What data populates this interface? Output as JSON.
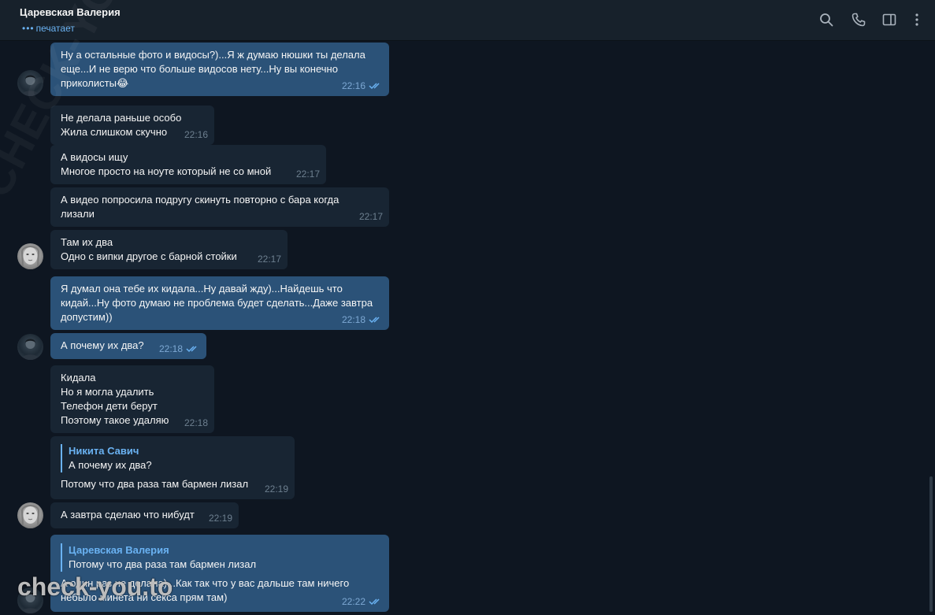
{
  "header": {
    "chat_name": "Царевская Валерия",
    "status_dots": "•••",
    "status": "печатает",
    "icons": [
      "search-icon",
      "phone-icon",
      "sidebar-toggle-icon",
      "more-vertical-icon"
    ]
  },
  "messages": [
    {
      "dir": "out",
      "text": "Ну а остальные фото и видосы?)...Я ж думаю нюшки ты делала\nеще...И не верю что больше видосов нету...Ну вы конечно\nприколисты😂",
      "time": "22:16",
      "read": true
    },
    {
      "dir": "in",
      "text": "Не делала раньше особо\nЖила слишком скучно",
      "time": "22:16"
    },
    {
      "dir": "in",
      "text": "А видосы ищу\nМногое просто на ноуте который не со мной",
      "time": "22:17"
    },
    {
      "dir": "in",
      "text": "А видео попросила подругу скинуть повторно с бара когда\nлизали",
      "time": "22:17"
    },
    {
      "dir": "in",
      "text": "Там их два\nОдно с випки другое с барной стойки",
      "time": "22:17"
    },
    {
      "dir": "out",
      "text": "Я думал она тебе их кидала...Ну давай жду)...Найдешь что\nкидай...Ну фото думаю не проблема будет сделать...Даже завтра\nдопустим))",
      "time": "22:18",
      "read": true
    },
    {
      "dir": "out",
      "text": "А почему их два?",
      "time": "22:18",
      "read": true
    },
    {
      "dir": "in",
      "text": "Кидала\nНо я могла удалить\nТелефон дети берут\nПоэтому такое удаляю",
      "time": "22:18"
    },
    {
      "dir": "in",
      "reply_author": "Никита Савич",
      "reply_text": "А почему их два?",
      "text": "Потому что два раза там бармен лизал",
      "time": "22:19"
    },
    {
      "dir": "in",
      "text": "А завтра сделаю что нибудт",
      "time": "22:19"
    },
    {
      "dir": "out",
      "reply_author": "Царевская Валерия",
      "reply_text": "Потому что два раза там бармен лизал",
      "text": "А один раз не делала)...Как так что у вас дальше там ничего\nнебыло минета ни секса прям там)",
      "time": "22:22",
      "read": true
    }
  ],
  "watermark": {
    "bottom": "check-you.to",
    "diagonal": "CHECK-YOU.ME"
  },
  "colors": {
    "background": "#0e1621",
    "header": "#17212b",
    "outgoing_bubble": "#2b5278",
    "incoming_bubble": "#182533",
    "accent": "#6ab2f2"
  }
}
